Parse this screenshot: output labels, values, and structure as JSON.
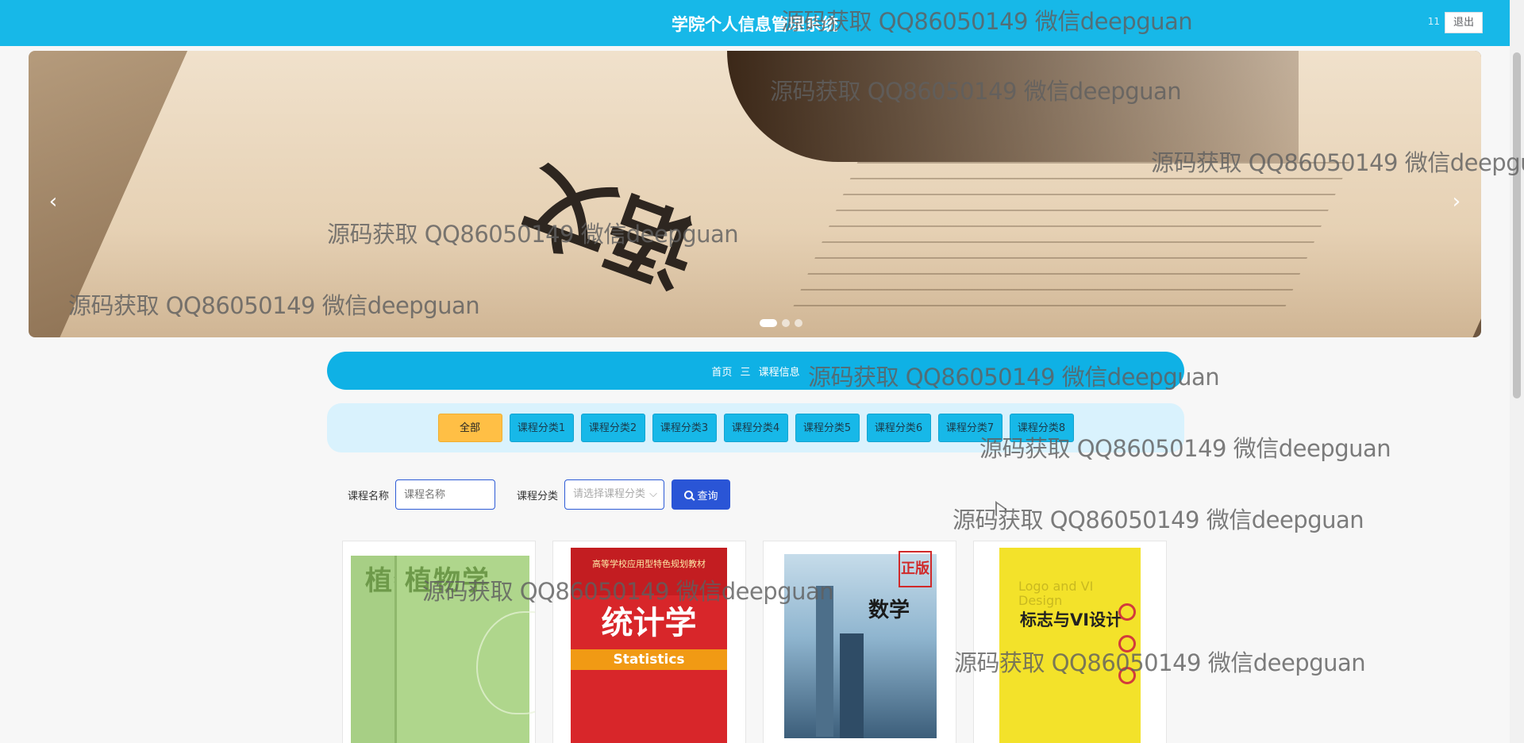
{
  "header": {
    "title": "学院个人信息管理系统",
    "user": "11",
    "logout_label": "退出"
  },
  "banner": {
    "prev_icon": "‹",
    "next_icon": "›",
    "image_text": "语文",
    "slides_count": 3,
    "active_slide": 1
  },
  "breadcrumb": {
    "home": "首页",
    "separator": "三",
    "current": "课程信息"
  },
  "categories": {
    "items": [
      "全部",
      "课程分类1",
      "课程分类2",
      "课程分类3",
      "课程分类4",
      "课程分类5",
      "课程分类6",
      "课程分类7",
      "课程分类8"
    ],
    "active": "全部"
  },
  "search": {
    "name_label": "课程名称",
    "name_placeholder": "课程名称",
    "category_label": "课程分类",
    "category_placeholder": "请选择课程分类",
    "button_label": "查询"
  },
  "cards": [
    {
      "cover_title": "植物学",
      "cover_title_2": "植物学"
    },
    {
      "cover_title": "统计学",
      "cover_subtitle": "Statistics",
      "cover_header": "高等学校应用型特色规划教材"
    },
    {
      "cover_title": "数学",
      "stamp": "正版"
    },
    {
      "cover_title_en": "Logo and VI Design",
      "cover_title": "标志与VI设计"
    }
  ],
  "watermark": {
    "text": "源码获取 QQ86050149 微信deepguan"
  },
  "colors": {
    "primary": "#17b8e8",
    "active_category": "#ffbf45",
    "search_button": "#2a55d6"
  }
}
